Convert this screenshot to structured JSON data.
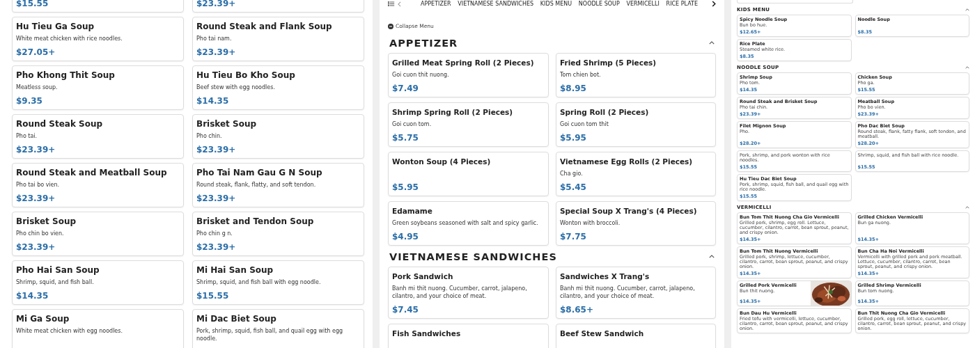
{
  "panels": [
    {
      "sections": [
        {
          "items": [
            {
              "price": "$15.55"
            },
            {
              "price": "$23.39+"
            },
            {
              "name": "Hu Tieu Ga Soup",
              "description": "White meat chicken with rice noodles.",
              "price": "$27.05+"
            },
            {
              "name": "Round Steak and Flank Soup",
              "description": "Pho tai nam.",
              "price": "$23.39+"
            },
            {
              "name": "Pho Khong Thit Soup",
              "description": "Meatless soup.",
              "price": "$9.35"
            },
            {
              "name": "Hu Tieu Bo Kho Soup",
              "description": "Beef stew with egg noodles.",
              "price": "$14.35"
            },
            {
              "name": "Round Steak Soup",
              "description": "Pho tai.",
              "price": "$23.39+"
            },
            {
              "name": "Brisket Soup",
              "description": "Pho chin.",
              "price": "$23.39+"
            },
            {
              "name": "Round Steak and Meatball Soup",
              "description": "Pho tai bo vien.",
              "price": "$23.39+"
            },
            {
              "name": "Pho Tai Nam Gau G N Soup",
              "description": "Round steak, flank, flatty, and soft tendon.",
              "price": "$23.39+"
            },
            {
              "name": "Brisket Soup",
              "description": "Pho chin bo vien.",
              "price": "$23.39+"
            },
            {
              "name": "Brisket and Tendon Soup",
              "description": "Pho chin g n.",
              "price": "$23.39+"
            },
            {
              "name": "Pho Hai San Soup",
              "description": "Shrimp, squid, and fish ball.",
              "price": "$14.35"
            },
            {
              "name": "Mi Hai San Soup",
              "description": "Shrimp, squid, and fish ball with egg noodle.",
              "price": "$15.55"
            },
            {
              "name": "Mi Ga Soup",
              "description": "White meat chicken with egg noodles."
            },
            {
              "name": "Mi Dac Biet Soup",
              "description": "Pork, shrimp, squid, fish ball, and quail egg with egg noodle."
            }
          ]
        }
      ]
    },
    {
      "nav": {
        "tabs": [
          {
            "label": "APPETIZER",
            "selected": false
          },
          {
            "label": "VIETNAMESE SANDWICHES",
            "selected": false
          },
          {
            "label": "KIDS MENU",
            "selected": false
          },
          {
            "label": "NOODLE SOUP",
            "selected": false
          },
          {
            "label": "VERMICELLI",
            "selected": false
          },
          {
            "label": "RICE PLATE",
            "selected": false
          }
        ]
      },
      "collapse_label": "Collapse Menu",
      "sections": [
        {
          "heading": "APPETIZER",
          "expanded": true,
          "items": [
            {
              "name": "Grilled Meat Spring Roll (2 Pieces)",
              "description": "Goi cuon thit nuong.",
              "price": "$7.49"
            },
            {
              "name": "Fried Shrimp (5 Pieces)",
              "description": "Tom chien bot.",
              "price": "$8.95"
            },
            {
              "name": "Shrimp Spring Roll (2 Pieces)",
              "description": "Goi cuon tom.",
              "price": "$5.75"
            },
            {
              "name": "Spring Roll (2 Pieces)",
              "description": "Goi cuon tom thit",
              "price": "$5.95"
            },
            {
              "name": "Wonton Soup (4 Pieces)",
              "price": "$5.95"
            },
            {
              "name": "Vietnamese Egg Rolls (2 Pieces)",
              "description": "Cha gio.",
              "price": "$5.45"
            },
            {
              "name": "Edamame",
              "description": "Green soybeans seasoned with salt and spicy garlic.",
              "price": "$4.95"
            },
            {
              "name": "Special Soup X Trang's (4 Pieces)",
              "description": "Wonton with broccoli.",
              "price": "$7.75"
            }
          ]
        },
        {
          "heading": "VIETNAMESE SANDWICHES",
          "expanded": true,
          "items": [
            {
              "name": "Pork Sandwich",
              "description": "Banh mi thit nuong. Cucumber, carrot, jalapeno, cilantro, and your choice of meat.",
              "price": "$7.45"
            },
            {
              "name": "Sandwiches X Trang's",
              "description": "Banh mi thit nuong. Cucumber, carrot, jalapeno, cilantro, and your choice of meat.",
              "price": "$8.65+"
            },
            {
              "name": "Fish Sandwiches"
            },
            {
              "name": "Beef Stew Sandwich"
            }
          ]
        }
      ]
    },
    {
      "sections": [
        {
          "heading": "KIDS MENU",
          "expanded": true,
          "items": [
            {
              "name": "Spicy Noodle Soup",
              "description": "Bun bo hue.",
              "price": "$12.65+"
            },
            {
              "name": "Noodle Soup",
              "price": "$8.35"
            },
            {
              "name": "Rice Plate",
              "description": "Steamed white rice.",
              "price": "$8.35"
            }
          ]
        },
        {
          "heading": "NOODLE SOUP",
          "expanded": true,
          "items": [
            {
              "name": "Shrimp Soup",
              "description": "Pho tom.",
              "price": "$14.35"
            },
            {
              "name": "Chicken Soup",
              "description": "Pho ga.",
              "price": "$15.55"
            },
            {
              "name": "Round Steak and Brisket Soup",
              "description": "Pho tai chin.",
              "price": "$23.39+"
            },
            {
              "name": "Meatball Soup",
              "description": "Pho bo vien.",
              "price": "$23.39+"
            },
            {
              "name": "Filet Mignon Soup",
              "description": "Pho.",
              "price": "$28.20+"
            },
            {
              "name": "Pho Dac Biet Soup",
              "description": "Round steak, flank, fatty flank, soft tendon, and meatball.",
              "price": "$28.20+"
            },
            {
              "description": "Pork, shrimp, and pork wonton with rice noodles.",
              "price": "$15.55"
            },
            {
              "description": "Shrimp, squid, and fish ball with rice noodle.",
              "price": "$15.55"
            },
            {
              "name": "Hu Tieu Dac Biet Soup",
              "description": "Pork, shrimp, squid, fish ball, and quail egg with rice noodle.",
              "price": "$15.55"
            }
          ]
        },
        {
          "heading": "VERMICELLI",
          "expanded": true,
          "items": [
            {
              "name": "Bun Tom Thit Nuong Cha Gio Vermicelli",
              "description": "Grilled pork, shrimp, egg roll. Lettuce, cucumber, cilantro, carrot, bean sprout, peanut, and crispy onion.",
              "price": "$14.35+"
            },
            {
              "name": "Grilled Chicken Vermicelli",
              "description": "Bun ga nuong.",
              "price": "$14.35+"
            },
            {
              "name": "Bun Tom Thit Nuong Vermicelli",
              "description": "Grilled pork, shrimp, lettuce, cucumber, cilantro, carrot, bean sprout, peanut, and crispy onion.",
              "price": "$14.35+"
            },
            {
              "name": "Bun Cha Ha Noi Vermicelli",
              "description": "Vermicelli with grilled pork and pork meatball. Lettuce, cucumber, cilantro, carrot, bean sprout, peanut, and crispy onion.",
              "price": "$14.35+"
            },
            {
              "name": "Grilled Pork Vermicelli",
              "description": "Bun thit nuong.",
              "price": "$14.35+"
            },
            {
              "name": "Grilled Shrimp Vermicelli",
              "description": "Bun tom nuong.",
              "price": "$14.35+"
            },
            {
              "name": "Bun Dau Hu Vermicelli",
              "description": "Fried tofu with vermicelli, lettuce, cucumber, cilantro, carrot, bean sprout, peanut, and crispy onion."
            },
            {
              "name": "Bun Thit Nuong Cha Gio Vermicelli",
              "description": "Grilled pork, egg roll, lettuce, cucumber, cilantro, carrot, bean sprout, peanut, and crispy onion."
            }
          ]
        }
      ]
    }
  ]
}
